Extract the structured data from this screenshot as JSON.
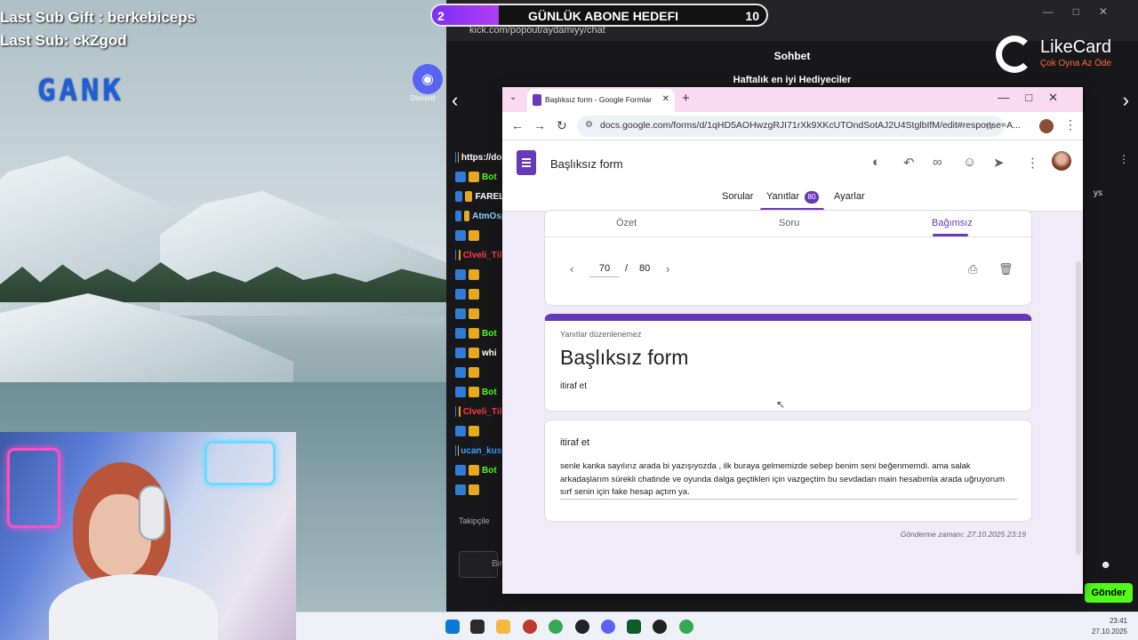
{
  "stream": {
    "last_sub_gift": "Last Sub Gift : berkebiceps",
    "last_sub": "Last Sub: ckZgod",
    "logo": "GANK",
    "discord_label": "Discord",
    "goal": {
      "current": "2",
      "title": "GÜNLÜK ABONE HEDEFI",
      "target": "10",
      "progress": 0.2
    }
  },
  "chat": {
    "url": "kick.com/popout/aydamiyy/chat",
    "title": "Sohbet",
    "likecard": {
      "name": "LikeCard",
      "slogan": "Çok Oyna  Az Öde"
    },
    "gifters": "Haftalık en iyi Hediyeciler",
    "rows": [
      {
        "text": "https://doc",
        "color": "#ffffff"
      },
      {
        "text": "Bot",
        "color": "#53fc18"
      },
      {
        "text": "FARELI",
        "color": "#ffffff"
      },
      {
        "text": "AtmOsp",
        "color": "#8fd3ff"
      },
      {
        "text": "",
        "color": "#ffd84a"
      },
      {
        "text": "Clveli_Tilk",
        "color": "#ff3b3b"
      },
      {
        "text": "",
        "color": "#ffd84a"
      },
      {
        "text": "",
        "color": "#ffd84a"
      },
      {
        "text": "",
        "color": "#ffd84a"
      },
      {
        "text": "Bot",
        "color": "#53fc18"
      },
      {
        "text": "whi",
        "color": "#ffffff"
      },
      {
        "text": "",
        "color": "#ffd84a"
      },
      {
        "text": "Bot",
        "color": "#53fc18"
      },
      {
        "text": "Clveli_Tilk",
        "color": "#ff3b3b"
      },
      {
        "text": "",
        "color": "#ffd84a"
      },
      {
        "text": "ucan_kusk",
        "color": "#3aa0ff"
      },
      {
        "text": "Bot",
        "color": "#53fc18"
      },
      {
        "text": "",
        "color": "#ffd84a"
      }
    ],
    "followers": "Takipçile",
    "input_placeholder": "Bir",
    "send": "Gönder",
    "right_fragment": "ys"
  },
  "browser": {
    "tab_title": "Başlıksız form - Google Formlar",
    "url": "docs.google.com/forms/d/1qHD5AOHwzgRJI71rXk9XKcUTOndSotAJ2U4StglbIfM/edit#response=A...",
    "form_title": "Başlıksız form",
    "tabs": {
      "questions": "Sorular",
      "responses": "Yanıtlar",
      "responses_count": "80",
      "settings": "Ayarlar"
    },
    "summary_tabs": {
      "summary": "Özet",
      "question": "Soru",
      "individual": "Bağımsız"
    },
    "pager": {
      "current": "70",
      "separator": "/",
      "total": "80"
    },
    "locked_note": "Yanıtlar düzenlenemez",
    "big_title": "Başlıksız form",
    "description": "itiraf et",
    "question": "itiraf et",
    "answer": "senle kanka sayılırız arada bi yazışıyozda , ilk buraya gelmemizde sebep benim seni beğenmemdi. ama salak arkadaşlarım sürekli chatinde ve oyunda  dalga geçtikleri için vazgeçtim bu sevdadan main hesabımla arada uğruyorum sırf senin için fake hesap açtım ya.",
    "submitted": "Gönderme zamanı: 27.10.2025 23:19"
  },
  "taskbar": {
    "time": "23:41",
    "date": "27.10.2025"
  },
  "colors": {
    "forms_purple": "#673ab7",
    "kick_green": "#53fc18"
  }
}
